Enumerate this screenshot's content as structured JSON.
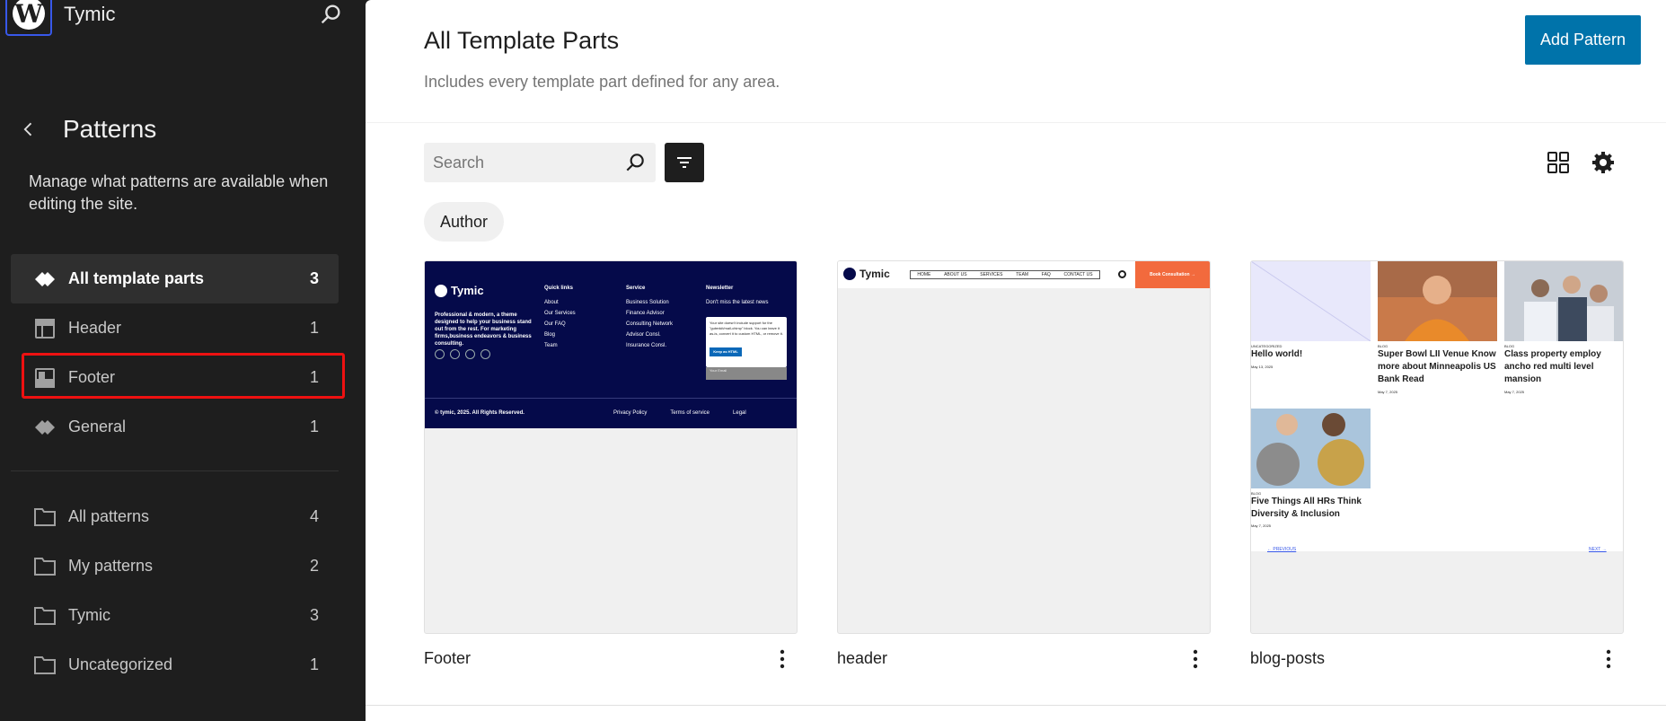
{
  "site": {
    "name": "Tymic"
  },
  "sidebar": {
    "title": "Patterns",
    "description": "Manage what patterns are available when editing the site.",
    "template_parts": [
      {
        "label": "All template parts",
        "count": "3",
        "icon": "symbol-icon"
      },
      {
        "label": "Header",
        "count": "1",
        "icon": "header-icon"
      },
      {
        "label": "Footer",
        "count": "1",
        "icon": "footer-icon"
      },
      {
        "label": "General",
        "count": "1",
        "icon": "symbol-icon"
      }
    ],
    "categories": [
      {
        "label": "All patterns",
        "count": "4",
        "icon": "folder-icon"
      },
      {
        "label": "My patterns",
        "count": "2",
        "icon": "folder-icon"
      },
      {
        "label": "Tymic",
        "count": "3",
        "icon": "folder-icon"
      },
      {
        "label": "Uncategorized",
        "count": "1",
        "icon": "folder-icon"
      }
    ]
  },
  "main": {
    "title": "All Template Parts",
    "description": "Includes every template part defined for any area.",
    "add_button": "Add Pattern",
    "search_placeholder": "Search",
    "filter_chip": "Author",
    "cards": [
      {
        "title": "Footer"
      },
      {
        "title": "header"
      },
      {
        "title": "blog-posts"
      }
    ]
  },
  "previews": {
    "footer": {
      "logo": "Tymic",
      "blurb": "Professional & modern, a theme designed to help your business stand out from the rest. For marketing firms,business endeavors & business consulting.",
      "quick_links_title": "Quick links",
      "quick_links": [
        "About",
        "Our Services",
        "Our FAQ",
        "Blog",
        "Team"
      ],
      "service_title": "Service",
      "services": [
        "Business Solution",
        "Finance Advisor",
        "Consulting Network",
        "Advisor Consl.",
        "Insurance Consl."
      ],
      "newsletter_title": "Newsletter",
      "newsletter_sub": "Don't miss the latest news",
      "newsletter_notice": "Your site doesn't include support for the \"gutenkit/mail-chimp\" block. You can leave it as-is, convert it to custom HTML, or remove it.",
      "newsletter_button": "Keep as HTML",
      "newsletter_field": "Your Email",
      "copyright": "© tymic, 2025. All Rights Reserved.",
      "legal_links": [
        "Privacy Policy",
        "Terms of service",
        "Legal"
      ]
    },
    "header": {
      "logo": "Tymic",
      "menu": [
        "HOME",
        "ABOUT US",
        "SERVICES",
        "TEAM",
        "FAQ",
        "CONTACT US"
      ],
      "cta": "Book Consultation →"
    },
    "blog": {
      "posts": [
        {
          "category": "UNCATEGORIZED",
          "title": "Hello world!",
          "date": "May 13, 2025"
        },
        {
          "category": "BLOG",
          "title": "Super Bowl LII Venue Know more about Minneapolis US Bank Read",
          "date": "May 7, 2025"
        },
        {
          "category": "BLOG",
          "title": "Class property employ ancho red multi level mansion",
          "date": "May 7, 2025"
        },
        {
          "category": "BLOG",
          "title": "Five Things All HRs Think Diversity & Inclusion",
          "date": "May 7, 2025"
        }
      ],
      "prev": "← PREVIOUS",
      "next": "NEXT →"
    }
  },
  "colors": {
    "accent": "#0073aa",
    "sidebar_bg": "#1e1e1e",
    "highlight": "#e11111"
  }
}
